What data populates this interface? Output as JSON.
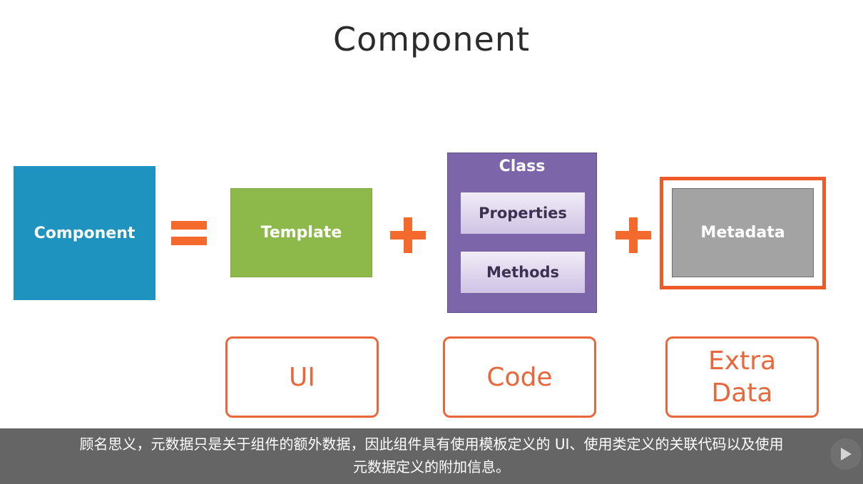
{
  "slide": {
    "title": "Component",
    "component_label": "Component",
    "template_label": "Template",
    "class": {
      "title": "Class",
      "properties_label": "Properties",
      "methods_label": "Methods"
    },
    "metadata_label": "Metadata",
    "labels": {
      "ui": "UI",
      "code": "Code",
      "extra_data": "Extra\nData"
    }
  },
  "subtitle": {
    "line1": "顾名思义，元数据只是关于组件的额外数据，因此组件具有使用模板定义的 UI、使用类定义的关联代码以及使用",
    "line2": "元数据定义的附加信息。"
  },
  "colors": {
    "component": "#1e93c0",
    "template": "#8cb94a",
    "class": "#7c65a8",
    "metadata": "#a3a3a3",
    "accent": "#f36a2c"
  },
  "icons": {
    "play": "play-icon"
  }
}
